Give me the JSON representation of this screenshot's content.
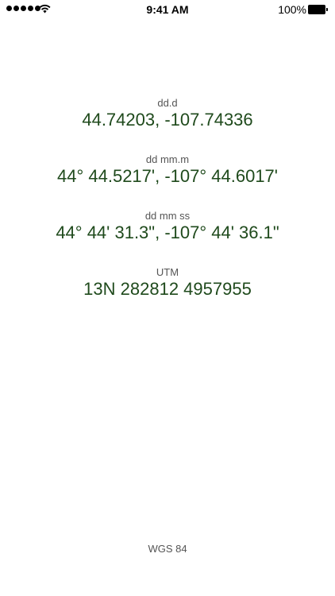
{
  "status_bar": {
    "time": "9:41 AM",
    "battery_percent": "100%",
    "signal_bars": 5,
    "icons": [
      "signal-dots-icon",
      "wifi-icon",
      "battery-icon"
    ]
  },
  "coordinates": {
    "ddd": {
      "label": "dd.d",
      "value": "44.74203, -107.74336"
    },
    "ddmm": {
      "label": "dd mm.m",
      "value": "44° 44.5217', -107° 44.6017'"
    },
    "ddmmss": {
      "label": "dd mm ss",
      "value": "44° 44' 31.3\", -107° 44' 36.1\""
    },
    "utm": {
      "label": "UTM",
      "value": "13N 282812 4957955"
    }
  },
  "datum": "WGS 84",
  "colors": {
    "value_text": "#1f4a1c",
    "label_text": "#555555",
    "background": "#ffffff"
  }
}
